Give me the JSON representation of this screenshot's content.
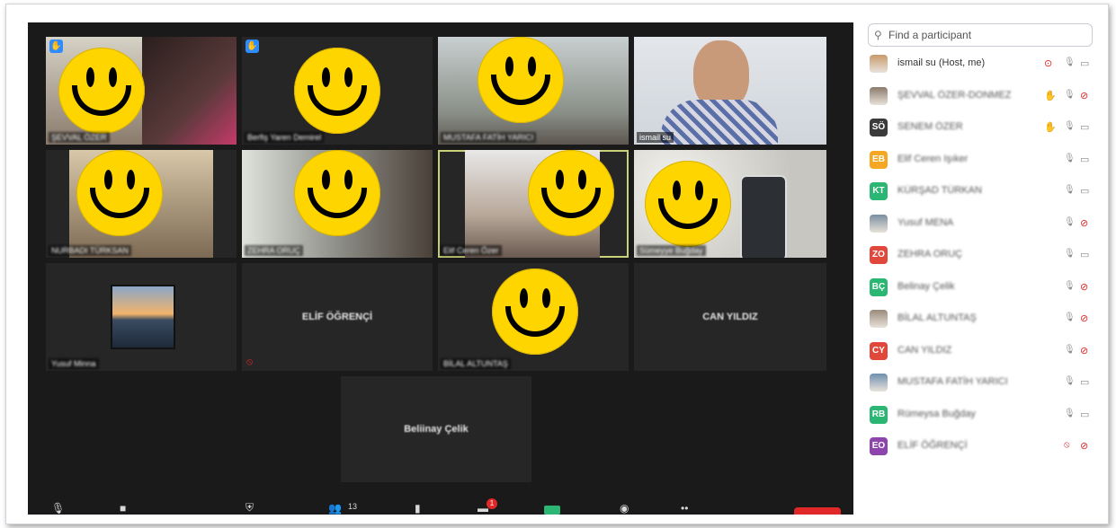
{
  "search": {
    "placeholder": "Find a participant"
  },
  "tiles": [
    {
      "name": "ŞEVVAL ÖZER",
      "raised_hand": true
    },
    {
      "name": "Berfiş Yaren Demirel",
      "raised_hand": true
    },
    {
      "name": "MUSTAFA FATİH YARICI"
    },
    {
      "name": "ismail su"
    },
    {
      "name": "NURBADI TÜRKSAN"
    },
    {
      "name": "ZEHRA ORUÇ"
    },
    {
      "name": "Elif Ceren Özer"
    },
    {
      "name": "Sümeyye Buğday"
    },
    {
      "name": "Yusuf Minna"
    },
    {
      "center_name": "ELİF ÖĞRENÇİ"
    },
    {
      "name": "BİLAL ALTUNTAŞ"
    },
    {
      "center_name": "CAN YILDIZ"
    },
    {
      "center_name": "Beliinay Çelik"
    }
  ],
  "toolbar": {
    "participants_count": "13",
    "chat_badge": "1"
  },
  "participants": [
    {
      "initials": "",
      "name": "ismail su (Host, me)",
      "av_color": "#c89a6a",
      "photo": true,
      "hand": false,
      "mic_muted": false,
      "video_off": false,
      "extra": "record"
    },
    {
      "initials": "",
      "name": "ŞEVVAL ÖZER-DONMEZ",
      "av_color": "#8a7a6a",
      "photo": true,
      "hand": true,
      "mic_muted": false,
      "video_off": true
    },
    {
      "initials": "SÖ",
      "name": "SENEM ÖZER",
      "av_color": "#3b3b3b",
      "hand": true,
      "mic_muted": false,
      "video_off": false
    },
    {
      "initials": "EB",
      "name": "Elif Ceren Işıker",
      "av_color": "#f5a623",
      "hand": false,
      "mic_muted": false,
      "video_off": false
    },
    {
      "initials": "KT",
      "name": "KÜRŞAD TÜRKAN",
      "av_color": "#2bb673",
      "hand": false,
      "mic_muted": false,
      "video_off": false
    },
    {
      "initials": "",
      "name": "Yusuf MENA",
      "av_color": "#7a8ea0",
      "photo": true,
      "hand": false,
      "mic_muted": false,
      "video_off": true
    },
    {
      "initials": "ZO",
      "name": "ZEHRA ORUÇ",
      "av_color": "#e0483b",
      "hand": false,
      "mic_muted": false,
      "video_off": false
    },
    {
      "initials": "BÇ",
      "name": "Belinay Çelik",
      "av_color": "#2bb673",
      "hand": false,
      "mic_muted": false,
      "video_off": true
    },
    {
      "initials": "",
      "name": "BİLAL ALTUNTAŞ",
      "av_color": "#9a8a7a",
      "photo": true,
      "hand": false,
      "mic_muted": false,
      "video_off": true
    },
    {
      "initials": "CY",
      "name": "CAN YILDIZ",
      "av_color": "#e0483b",
      "hand": false,
      "mic_muted": false,
      "video_off": true
    },
    {
      "initials": "",
      "name": "MUSTAFA FATİH YARICI",
      "av_color": "#6f8fb0",
      "photo": true,
      "hand": false,
      "mic_muted": false,
      "video_off": false
    },
    {
      "initials": "RB",
      "name": "Rümeysa Buğday",
      "av_color": "#2bb673",
      "hand": false,
      "mic_muted": false,
      "video_off": false
    },
    {
      "initials": "EO",
      "name": "ELİF ÖĞRENÇİ",
      "av_color": "#8e44ad",
      "hand": false,
      "mic_muted": true,
      "video_off": true
    }
  ]
}
